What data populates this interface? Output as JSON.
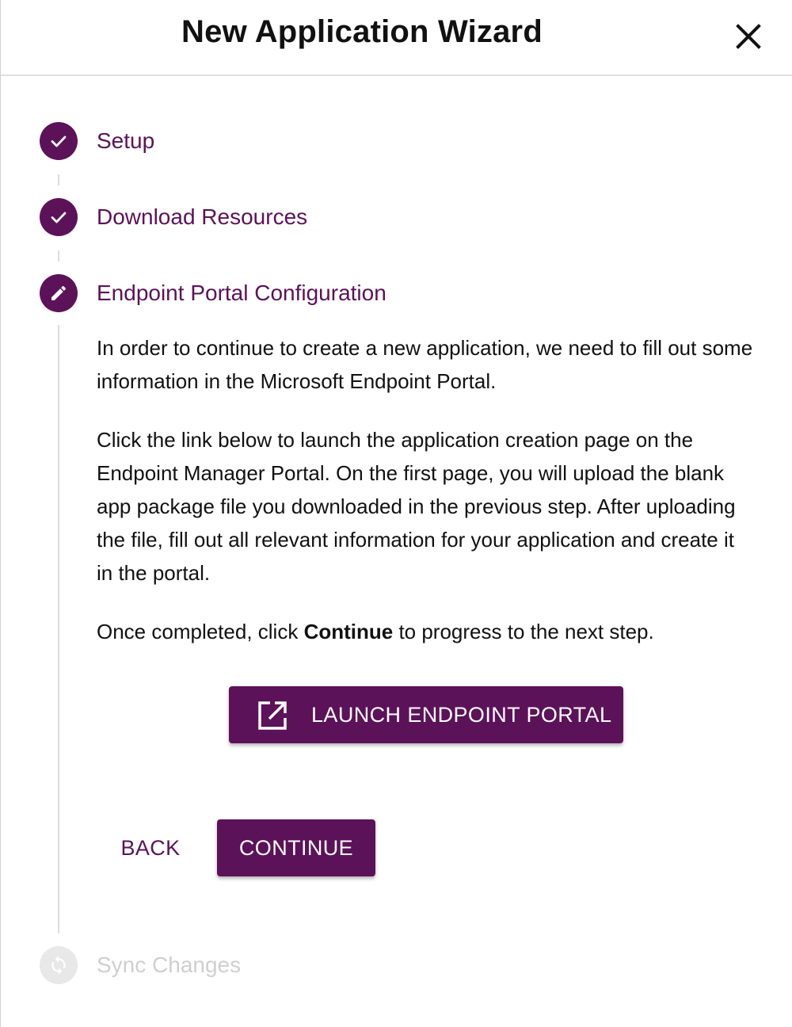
{
  "dialog": {
    "title": "New Application Wizard",
    "close_icon": "close-icon"
  },
  "steps": [
    {
      "label": "Setup",
      "state": "completed",
      "icon": "check-icon"
    },
    {
      "label": "Download Resources",
      "state": "completed",
      "icon": "check-icon"
    },
    {
      "label": "Endpoint Portal Configuration",
      "state": "active",
      "icon": "pencil-icon"
    },
    {
      "label": "Sync Changes",
      "state": "disabled",
      "icon": "sync-icon"
    }
  ],
  "content": {
    "paragraph1": "In order to continue to create a new application, we need to fill out some information in the Microsoft Endpoint Portal.",
    "paragraph2": "Click the link below to launch the application creation page on the Endpoint Manager Portal. On the first page, you will upload the blank app package file you downloaded in the previous step. After uploading the file, fill out all relevant information for your application and create it in the portal.",
    "paragraph3_before": "Once completed, click ",
    "paragraph3_bold": "Continue",
    "paragraph3_after": " to progress to the next step."
  },
  "buttons": {
    "launch_label": "LAUNCH ENDPOINT PORTAL",
    "launch_icon": "open-in-new-icon",
    "back_label": "BACK",
    "continue_label": "CONTINUE"
  },
  "colors": {
    "primary": "#5c1259",
    "disabled_circle": "#e8e8e8",
    "disabled_text": "#cfcfcf",
    "connector": "#dcdcdc"
  }
}
